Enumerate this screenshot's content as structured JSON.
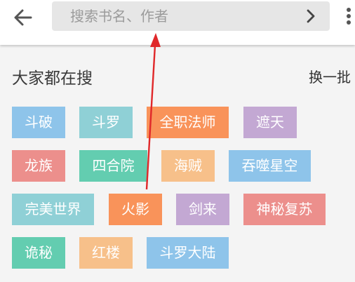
{
  "header": {
    "back_icon": "back-arrow-icon",
    "search": {
      "placeholder": "搜索书名、作者",
      "value": ""
    },
    "go_icon": "chevron-right-icon",
    "more_icon": "more-vertical-icon"
  },
  "hot_search": {
    "title": "大家都在搜",
    "refresh_label": "换一批",
    "tags": [
      {
        "label": "斗破",
        "color": "#8ec4ea"
      },
      {
        "label": "斗罗",
        "color": "#8fd0d6"
      },
      {
        "label": "全职法师",
        "color": "#f9935a"
      },
      {
        "label": "遮天",
        "color": "#c3a8d3"
      },
      {
        "label": "龙族",
        "color": "#ec8f8c"
      },
      {
        "label": "四合院",
        "color": "#63cdb0"
      },
      {
        "label": "海贼",
        "color": "#f7c08a"
      },
      {
        "label": "吞噬星空",
        "color": "#8ec4ea"
      },
      {
        "label": "完美世界",
        "color": "#8fd0d6"
      },
      {
        "label": "火影",
        "color": "#f9935a"
      },
      {
        "label": "剑来",
        "color": "#c3a8d3"
      },
      {
        "label": "神秘复苏",
        "color": "#ec8f8c"
      },
      {
        "label": "诡秘",
        "color": "#63cdb0"
      },
      {
        "label": "红楼",
        "color": "#f7c08a"
      },
      {
        "label": "斗罗大陆",
        "color": "#8ec4ea"
      }
    ]
  },
  "annotation": {
    "type": "arrow",
    "color": "#e0282a"
  }
}
